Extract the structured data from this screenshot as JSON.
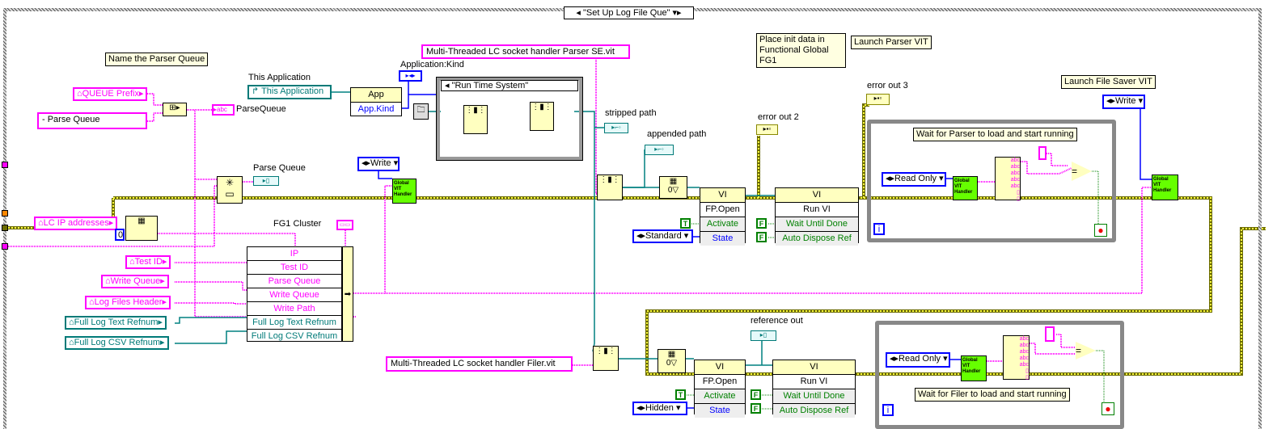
{
  "case_selector": "\"Set Up Log File Que\"",
  "comments": {
    "name_parser_queue": "Name the Parser Queue",
    "place_init": "Place init data in Functional Global FG1",
    "launch_parser": "Launch Parser VIT",
    "launch_saver": "Launch File Saver VIT",
    "wait_parser": "Wait for Parser to load and start running",
    "wait_filer": "Wait for Filer to load and start running"
  },
  "controls": {
    "queue_prefix": "QUEUE Prefix",
    "parse_queue_const": "- Parse Queue",
    "parse_queue_ind": "ParseQueue",
    "this_app_label": "This Application",
    "this_app": "This Application",
    "app_node_title": "App",
    "app_kind": "App.Kind",
    "app_kind_label": "Application:Kind",
    "case_run_time": "\"Run Time System\"",
    "parser_vit": "Multi-Threaded LC socket handler Parser SE.vit",
    "filer_vit": "Multi-Threaded LC socket handler Filer.vit",
    "stripped_path": "stripped path",
    "appended_path": "appended path",
    "parse_queue_label": "Parse Queue",
    "write_enum": "Write",
    "lc_ip": "LC IP addresses",
    "zero": "0",
    "fg1_cluster": "FG1  Cluster",
    "test_id": "Test ID",
    "write_queue": "Write Queue",
    "log_files_header": "Log Files Header",
    "full_log_text": "Full Log Text Refnum",
    "full_log_csv": "Full Log CSV Refnum",
    "error_out_2": "error out 2",
    "error_out_3": "error out 3",
    "reference_out": "reference out",
    "read_only": "Read Only",
    "global_vit": "Global VIT Handler",
    "standard": "Standard",
    "hidden": "Hidden",
    "true_const": "T",
    "false_const": "F",
    "iteration": "i"
  },
  "bundle_rows": [
    "IP",
    "Test ID",
    "Parse Queue",
    "Write Queue",
    "Write Path",
    "Full Log Text Refnum",
    "Full Log CSV Refnum"
  ],
  "fp_open": {
    "header": "VI",
    "title": "FP.Open",
    "activate": "Activate",
    "state": "State"
  },
  "run_vi": {
    "header": "VI",
    "title": "Run VI",
    "wait": "Wait Until Done",
    "dispose": "Auto Dispose Ref"
  },
  "colors": {
    "string_wire": "#ff00ff",
    "error_wire": "#c8c800",
    "refnum_wire": "#008080",
    "enum": "#0000ff",
    "global_vi": "#66ff00"
  }
}
